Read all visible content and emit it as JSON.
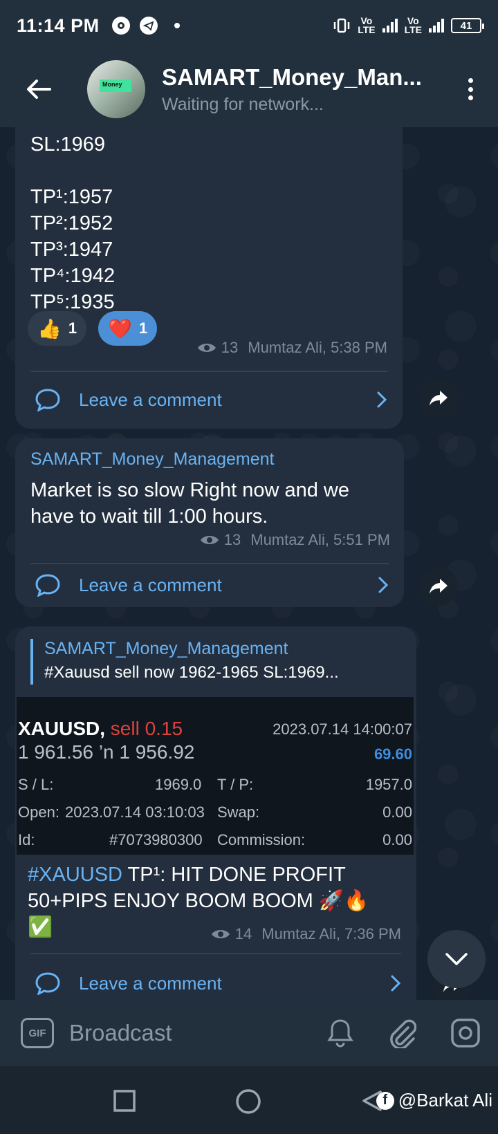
{
  "status_bar": {
    "time": "11:14 PM",
    "net1": "Vo\nLTE",
    "net2": "Vo\nLTE",
    "battery": "41"
  },
  "header": {
    "title": "SAMART_Money_Man...",
    "status": "Waiting for network...",
    "avatar_text": "Money"
  },
  "messages": [
    {
      "lines": [
        "SL:1969",
        "",
        "TP¹:1957",
        "TP²:1952",
        "TP³:1947",
        "TP⁴:1942",
        "TP⁵:1935"
      ],
      "reactions": [
        {
          "emoji": "👍",
          "count": "1"
        },
        {
          "emoji": "❤️",
          "count": "1"
        }
      ],
      "views": "13",
      "author_time": "Mumtaz Ali, 5:38 PM",
      "comment": "Leave a comment"
    },
    {
      "sender": "SAMART_Money_Management",
      "text": "Market is so slow Right now and we have to wait till 1:00 hours.",
      "views": "13",
      "author_time": "Mumtaz Ali, 5:51 PM",
      "comment": "Leave a comment"
    },
    {
      "reply_sender": "SAMART_Money_Management",
      "reply_text": "#Xauusd sell now 1962-1965  SL:1969...",
      "trade": {
        "symbol": "XAUUSD,",
        "side": "sell 0.15",
        "datetime": "2023.07.14 14:00:07",
        "prices": "1 961.56 ’n  1 956.92",
        "profit": "69.60",
        "sl_label": "S / L:",
        "sl_value": "1969.0",
        "tp_label": "T / P:",
        "tp_value": "1957.0",
        "open_label": "Open:",
        "open_value": "2023.07.14 03:10:03",
        "swap_label": "Swap:",
        "swap_value": "0.00",
        "id_label": "Id:",
        "id_value": "#7073980300",
        "commission_label": "Commission:",
        "commission_value": "0.00"
      },
      "hashtag": "#XAUUSD",
      "text_rest": " TP¹: HIT DONE PROFIT 50+PIPS ENJOY BOOM BOOM 🚀🔥",
      "text_emoji": "✅",
      "views": "14",
      "author_time": "Mumtaz Ali, 7:36 PM",
      "comment": "Leave a comment"
    }
  ],
  "input": {
    "gif": "GIF",
    "placeholder": "Broadcast"
  },
  "watermark": "@Barkat Ali",
  "colors": {
    "accent": "#6ab3f3",
    "bubble": "#232f3e",
    "header": "#222f3c"
  }
}
